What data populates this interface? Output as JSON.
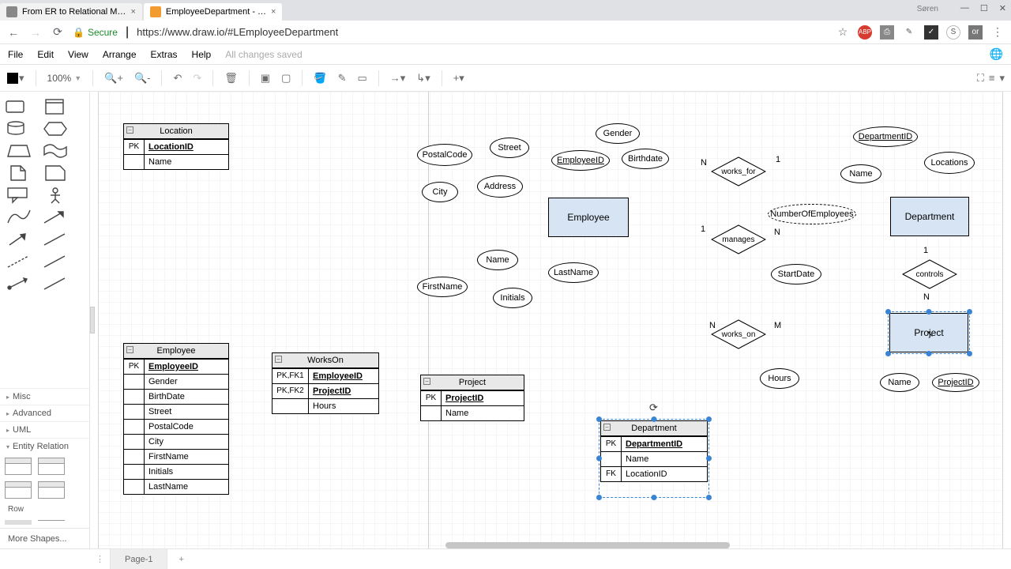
{
  "browser": {
    "tabs": [
      {
        "title": "From ER to Relational M…"
      },
      {
        "title": "EmployeeDepartment - …"
      }
    ],
    "user": "Søren",
    "secure_label": "Secure",
    "url": "https://www.draw.io/#LEmployeeDepartment"
  },
  "menu": {
    "items": [
      "File",
      "Edit",
      "View",
      "Arrange",
      "Extras",
      "Help"
    ],
    "status": "All changes saved"
  },
  "toolbar": {
    "zoom": "100%"
  },
  "tables": {
    "location": {
      "title": "Location",
      "rows": [
        {
          "key": "PK",
          "val": "LocationID",
          "pk": true
        },
        {
          "key": "",
          "val": "Name"
        }
      ]
    },
    "employee": {
      "title": "Employee",
      "rows": [
        {
          "key": "PK",
          "val": "EmployeeID",
          "pk": true
        },
        {
          "key": "",
          "val": "Gender"
        },
        {
          "key": "",
          "val": "BirthDate"
        },
        {
          "key": "",
          "val": "Street"
        },
        {
          "key": "",
          "val": "PostalCode"
        },
        {
          "key": "",
          "val": "City"
        },
        {
          "key": "",
          "val": "FirstName"
        },
        {
          "key": "",
          "val": "Initials"
        },
        {
          "key": "",
          "val": "LastName"
        }
      ]
    },
    "workson": {
      "title": "WorksOn",
      "rows": [
        {
          "key": "PK,FK1",
          "val": "EmployeeID",
          "pk": true
        },
        {
          "key": "PK,FK2",
          "val": "ProjectID",
          "pk": true
        },
        {
          "key": "",
          "val": "Hours"
        }
      ]
    },
    "project": {
      "title": "Project",
      "rows": [
        {
          "key": "PK",
          "val": "ProjectID",
          "pk": true
        },
        {
          "key": "",
          "val": "Name"
        }
      ]
    },
    "department": {
      "title": "Department",
      "rows": [
        {
          "key": "PK",
          "val": "DepartmentID",
          "pk": true
        },
        {
          "key": "",
          "val": "Name"
        },
        {
          "key": "FK",
          "val": "LocationID"
        }
      ]
    }
  },
  "entities": {
    "employee": "Employee",
    "department": "Department",
    "project": "Project"
  },
  "attrs": {
    "postalcode": "PostalCode",
    "street": "Street",
    "city": "City",
    "address": "Address",
    "employeeid": "EmployeeID",
    "gender": "Gender",
    "birthdate": "Birthdate",
    "name_emp": "Name",
    "firstname": "FirstName",
    "lastname": "LastName",
    "initials": "Initials",
    "departmentid": "DepartmentID",
    "locations": "Locations",
    "name_dep": "Name",
    "numberofemployees": "NumberOfEmployees",
    "startdate": "StartDate",
    "hours": "Hours",
    "name_proj": "Name",
    "projectid": "ProjectID"
  },
  "rels": {
    "works_for": "works_for",
    "manages": "manages",
    "works_on": "works_on",
    "controls": "controls"
  },
  "card": {
    "n": "N",
    "m": "M",
    "one": "1"
  },
  "sidebar_cats": {
    "misc": "Misc",
    "advanced": "Advanced",
    "uml": "UML",
    "er": "Entity Relation",
    "row": "Row"
  },
  "footer": {
    "more": "More Shapes...",
    "page": "Page-1"
  }
}
